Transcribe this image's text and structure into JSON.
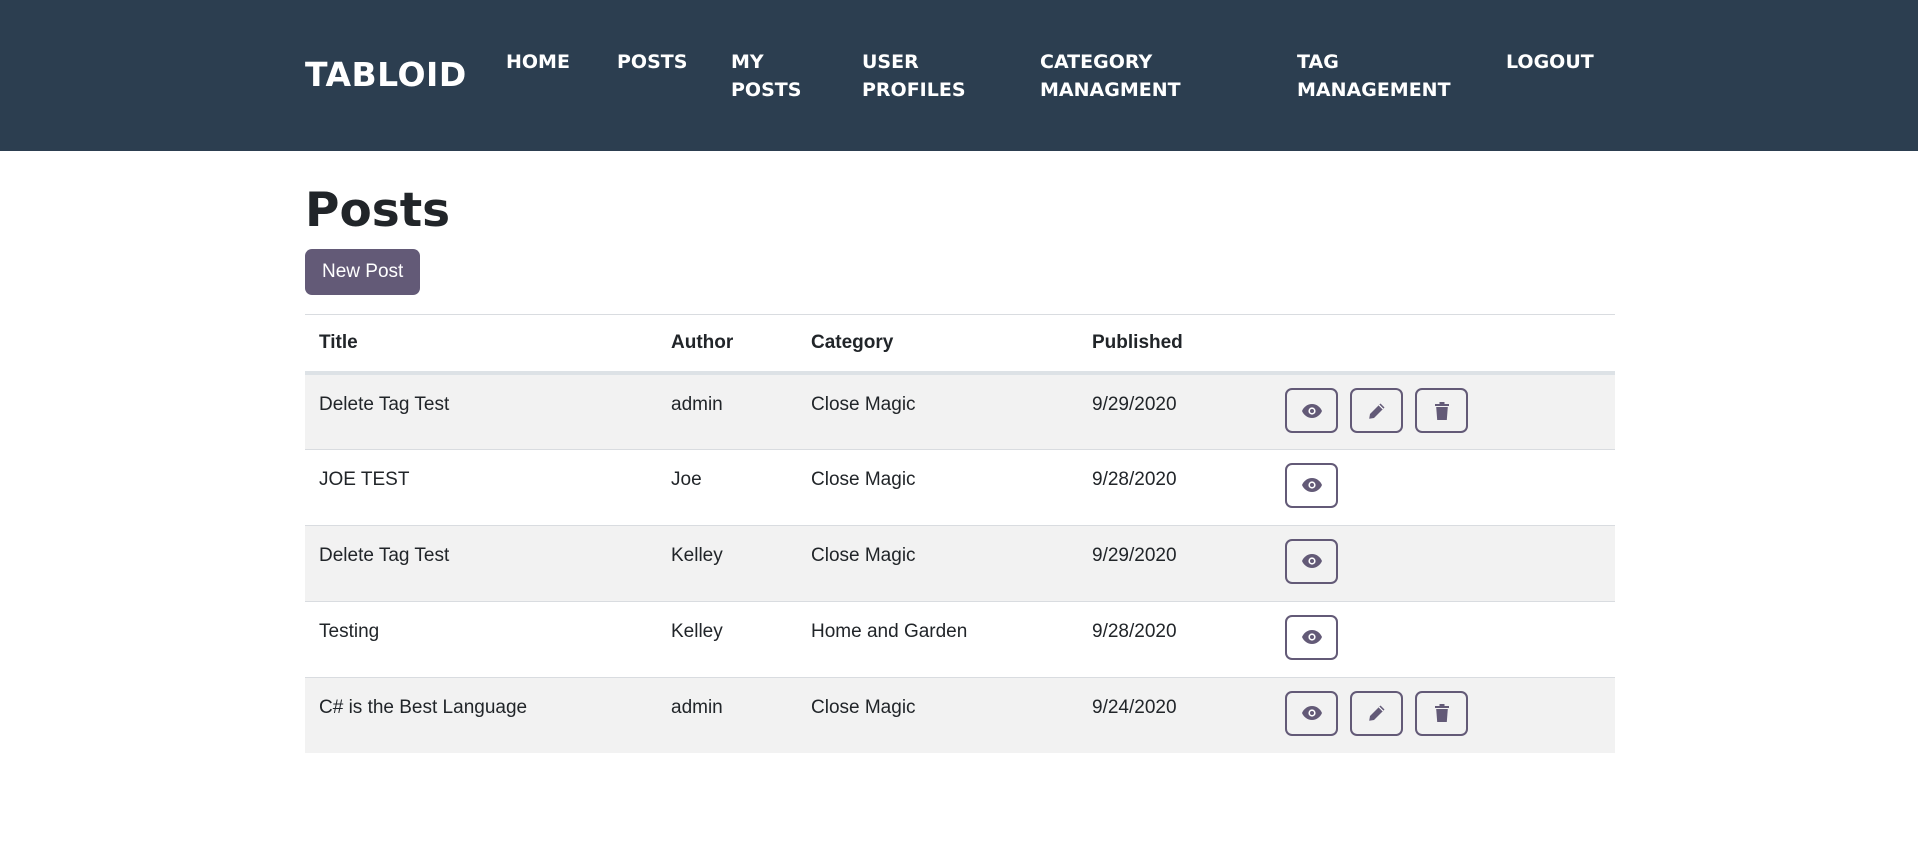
{
  "brand": "TABLOID",
  "nav": [
    {
      "lines": [
        "HOME"
      ]
    },
    {
      "lines": [
        "POSTS"
      ]
    },
    {
      "lines": [
        "MY",
        "POSTS"
      ]
    },
    {
      "lines": [
        "USER",
        "PROFILES"
      ]
    },
    {
      "lines": [
        "CATEGORY",
        "MANAGMENT"
      ]
    },
    {
      "lines": [
        "TAG",
        "MANAGEMENT"
      ]
    },
    {
      "lines": [
        "LOGOUT"
      ]
    }
  ],
  "page": {
    "title": "Posts",
    "new_post_label": "New Post"
  },
  "table": {
    "headers": [
      "Title",
      "Author",
      "Category",
      "Published"
    ],
    "rows": [
      {
        "title": "Delete Tag Test",
        "author": "admin",
        "category": "Close Magic",
        "published": "9/29/2020",
        "actions": [
          "view",
          "edit",
          "delete"
        ]
      },
      {
        "title": "JOE TEST",
        "author": "Joe",
        "category": "Close Magic",
        "published": "9/28/2020",
        "actions": [
          "view"
        ]
      },
      {
        "title": "Delete Tag Test",
        "author": "Kelley",
        "category": "Close Magic",
        "published": "9/29/2020",
        "actions": [
          "view"
        ]
      },
      {
        "title": "Testing",
        "author": "Kelley",
        "category": "Home and Garden",
        "published": "9/28/2020",
        "actions": [
          "view"
        ]
      },
      {
        "title": "C# is the Best Language",
        "author": "admin",
        "category": "Close Magic",
        "published": "9/24/2020",
        "actions": [
          "view",
          "edit",
          "delete"
        ]
      }
    ]
  },
  "icons": {
    "view": "eye-icon",
    "edit": "pencil-icon",
    "delete": "trash-icon"
  },
  "colors": {
    "navbar": "#2c3e50",
    "accent": "#635a77",
    "row_stripe": "#f2f2f2"
  }
}
